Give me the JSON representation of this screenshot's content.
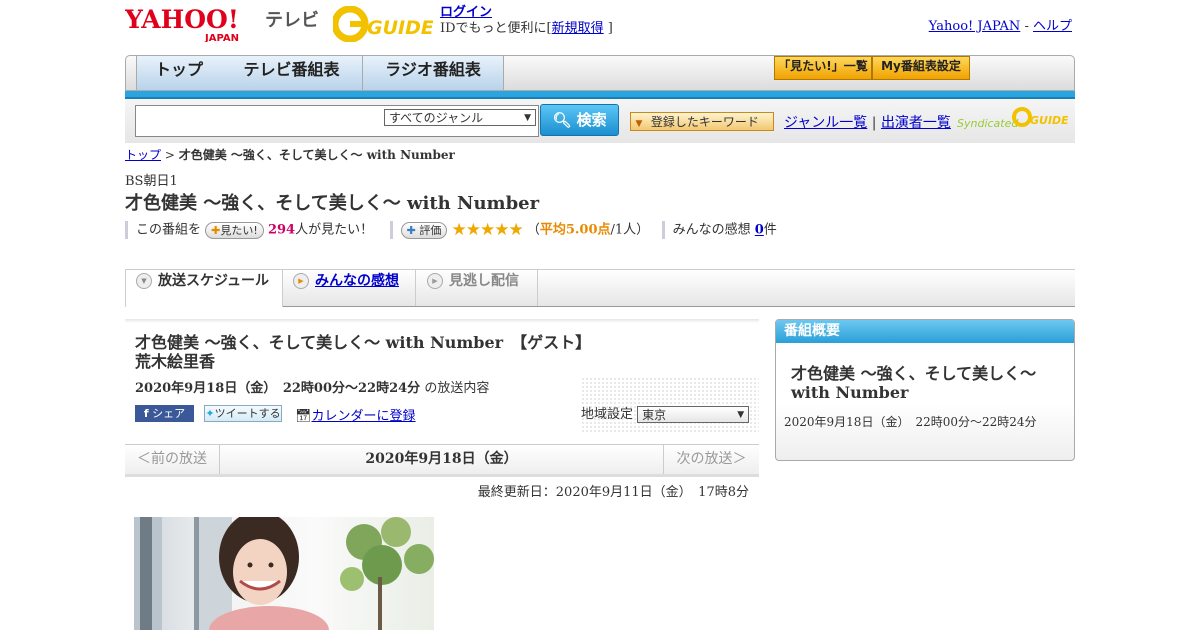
{
  "header": {
    "logo_text": "YAHOO!",
    "logo_sub": "JAPAN",
    "tv_label": "テレビ",
    "gguide_text": "GUIDE",
    "login_link": "ログイン",
    "login_prefix": "IDでもっと便利に[",
    "register_link": "新規取得",
    "login_suffix": "]",
    "yahoo_japan_link": "Yahoo! JAPAN",
    "dash": "-",
    "help_link": "ヘルプ"
  },
  "nav": {
    "tabs": [
      "トップ",
      "テレビ番組表",
      "ラジオ番組表"
    ],
    "want_list_button": "「見たい!」一覧",
    "my_schedule_button": "My番組表設定"
  },
  "search": {
    "placeholder": "",
    "genre_selected": "すべてのジャンル",
    "search_button": "検索",
    "keyword_button": "登録したキーワード",
    "genre_list_link": "ジャンル一覧",
    "divider": "|",
    "performer_list_link": "出演者一覧",
    "syndicated_label": "Syndicated"
  },
  "breadcrumb": {
    "top_link": "トップ",
    "separator": ">",
    "current": "才色健美 ～強く、そして美しく～ with Number"
  },
  "program": {
    "channel": "BS朝日1",
    "title": "才色健美 ～強く、そして美しく～ with Number",
    "this_program_label": "この番組を",
    "want_button": "見たい!",
    "want_count": "294",
    "want_suffix": "人が見たい！",
    "rate_button": "評価",
    "stars": "★★★★★",
    "rating_open": "（",
    "avg_label": "平均5.00点",
    "rating_count": "/1人）",
    "impressions_label": "みんなの感想",
    "impressions_count": "0",
    "impressions_suffix": "件"
  },
  "tabs": {
    "schedule": "放送スケジュール",
    "impressions": "みんなの感想",
    "streaming": "見逃し配信"
  },
  "episode": {
    "title": "才色健美 ～強く、そして美しく～ with Number　【ゲスト】荒木絵里香",
    "datetime": "2020年9月18日（金）　22時00分～22時24分",
    "datetime_suffix": "の放送内容",
    "facebook_share": "シェア",
    "tweet": "ツイートする",
    "calendar_link": "カレンダーに登録",
    "region_label": "地域設定",
    "region_selected": "東京",
    "prev_broadcast": "＜前の放送",
    "current_date": "2020年9月18日（金）",
    "next_broadcast": "次の放送＞",
    "last_updated": "最終更新日：2020年9月11日（金）　17時8分"
  },
  "overview": {
    "header": "番組概要",
    "title": "才色健美 ～強く、そして美しく～ with Number",
    "time": "2020年9月18日（金）　22時00分～22時24分"
  }
}
